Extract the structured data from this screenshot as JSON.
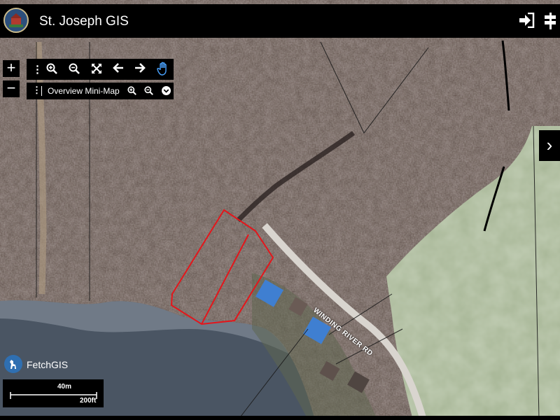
{
  "header": {
    "title": "St. Joseph GIS",
    "login_icon": "sign-in-icon",
    "menu_icon": "signpost-icon"
  },
  "zoom": {
    "in_label": "+",
    "out_label": "−"
  },
  "toolbar": {
    "icons": [
      "drag-handle-icon",
      "zoom-in-icon",
      "zoom-out-icon",
      "full-extent-icon",
      "back-arrow-icon",
      "forward-arrow-icon",
      "pan-hand-icon"
    ]
  },
  "minimap": {
    "label": "Overview Mini-Map",
    "icons": [
      "drag-handle-icon",
      "zoom-in-icon",
      "zoom-out-icon",
      "chevron-down-icon"
    ]
  },
  "map": {
    "road_label": "WINDING RIVER RD",
    "colors": {
      "parcel_outline": "#e4161b",
      "water": "#4a5563",
      "field": "#a6b595",
      "woods": "#5a4a44"
    }
  },
  "brand": {
    "label": "FetchGIS"
  },
  "scale": {
    "metric": "40m",
    "imperial": "200ft"
  },
  "side_panel": {
    "toggle_icon": "chevron-right-icon"
  }
}
